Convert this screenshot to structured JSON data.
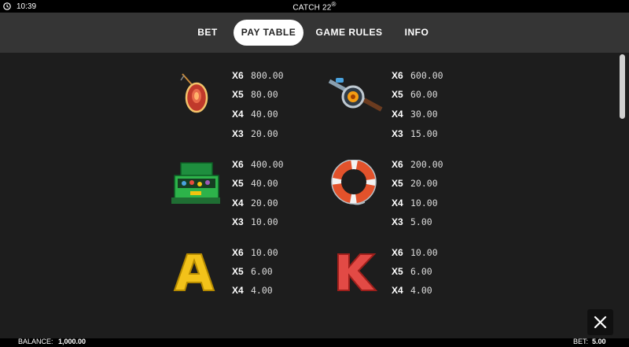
{
  "status_bar": {
    "time": "10:39",
    "title": "CATCH 22",
    "title_mark": "®"
  },
  "tabs": [
    {
      "label": "BET",
      "active": false
    },
    {
      "label": "PAY TABLE",
      "active": true
    },
    {
      "label": "GAME RULES",
      "active": false
    },
    {
      "label": "INFO",
      "active": false
    }
  ],
  "paytable": [
    {
      "symbol": "fishing-lure-icon",
      "pays": [
        {
          "mult": "X6",
          "value": "800.00"
        },
        {
          "mult": "X5",
          "value": "80.00"
        },
        {
          "mult": "X4",
          "value": "40.00"
        },
        {
          "mult": "X3",
          "value": "20.00"
        }
      ]
    },
    {
      "symbol": "fishing-reel-icon",
      "pays": [
        {
          "mult": "X6",
          "value": "600.00"
        },
        {
          "mult": "X5",
          "value": "60.00"
        },
        {
          "mult": "X4",
          "value": "30.00"
        },
        {
          "mult": "X3",
          "value": "15.00"
        }
      ]
    },
    {
      "symbol": "tackle-box-icon",
      "pays": [
        {
          "mult": "X6",
          "value": "400.00"
        },
        {
          "mult": "X5",
          "value": "40.00"
        },
        {
          "mult": "X4",
          "value": "20.00"
        },
        {
          "mult": "X3",
          "value": "10.00"
        }
      ]
    },
    {
      "symbol": "life-ring-icon",
      "pays": [
        {
          "mult": "X6",
          "value": "200.00"
        },
        {
          "mult": "X5",
          "value": "20.00"
        },
        {
          "mult": "X4",
          "value": "10.00"
        },
        {
          "mult": "X3",
          "value": "5.00"
        }
      ]
    },
    {
      "symbol": "letter-a-icon",
      "letter": "A",
      "pays": [
        {
          "mult": "X6",
          "value": "10.00"
        },
        {
          "mult": "X5",
          "value": "6.00"
        },
        {
          "mult": "X4",
          "value": "4.00"
        }
      ]
    },
    {
      "symbol": "letter-k-icon",
      "letter": "K",
      "pays": [
        {
          "mult": "X6",
          "value": "10.00"
        },
        {
          "mult": "X5",
          "value": "6.00"
        },
        {
          "mult": "X4",
          "value": "4.00"
        }
      ]
    }
  ],
  "bottom_bar": {
    "balance_label": "BALANCE:",
    "balance_value": "1,000.00",
    "bet_label": "BET:",
    "bet_value": "5.00"
  },
  "colors": {
    "tab_bar": "#353535",
    "background": "#1d1d1d",
    "active_tab": "#ffffff",
    "letter_a": "#f2c21a",
    "letter_k": "#e24a45"
  }
}
